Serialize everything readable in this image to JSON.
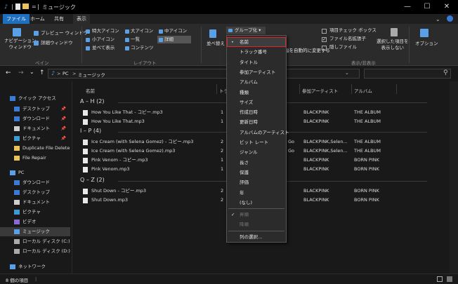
{
  "titlebar": {
    "path_separator": "|",
    "quick_dropdown": "=",
    "folder_title": "ミュージック",
    "minimize": "—",
    "maximize": "☐",
    "close": "✕"
  },
  "tabs": [
    "ファイル",
    "ホーム",
    "共有",
    "表示"
  ],
  "ribbon": {
    "pane_group": {
      "nav_pane": "ナビゲーション\nウィンドウ",
      "preview_pane": "プレビュー ウィンドウ",
      "details_pane": "詳細ウィンドウ",
      "label": "ペイン"
    },
    "layout_group": {
      "items": [
        "特大アイコン",
        "大アイコン",
        "中アイコン",
        "小アイコン",
        "一覧",
        "詳細",
        "並べて表示",
        "コンテンツ"
      ],
      "label": "レイアウト"
    },
    "view_group": {
      "sort": "並べ替え",
      "group_by": "グループ化 ▾",
      "size_all_columns": "列の幅を自動的に変更する"
    },
    "show_hide": {
      "item_checkboxes": "項目チェック ボックス",
      "file_extensions": "ファイル名拡張子",
      "hidden_items": "隠しファイル",
      "hide_selected": "選択した項目を\n表示しない",
      "options": "オプション",
      "label": "表示/非表示"
    }
  },
  "address": {
    "back": "←",
    "forward": "→",
    "recent": "⌄",
    "up": "↑",
    "path": [
      "PC",
      "ミュージック"
    ],
    "path_separators": [
      ">",
      ">"
    ],
    "refresh": "⌄",
    "search_icon": "⚲"
  },
  "nav_pane": [
    {
      "label": "クイック アクセス",
      "icon": "star-icon",
      "pinned": false,
      "indent": 0
    },
    {
      "label": "デスクトップ",
      "icon": "desktop-icon",
      "pinned": true,
      "indent": 1
    },
    {
      "label": "ダウンロード",
      "icon": "download-icon",
      "pinned": true,
      "indent": 1
    },
    {
      "label": "ドキュメント",
      "icon": "document-icon",
      "pinned": true,
      "indent": 1
    },
    {
      "label": "ピクチャ",
      "icon": "picture-icon",
      "pinned": true,
      "indent": 1
    },
    {
      "label": "Duplicate File Deleter",
      "icon": "folder-icon",
      "pinned": false,
      "indent": 1
    },
    {
      "label": "File Repair",
      "icon": "folder-icon",
      "pinned": false,
      "indent": 1
    },
    {
      "label": "PC",
      "icon": "pc-icon",
      "pinned": false,
      "indent": 0
    },
    {
      "label": "ダウンロード",
      "icon": "download-icon",
      "pinned": false,
      "indent": 1
    },
    {
      "label": "デスクトップ",
      "icon": "desktop-icon",
      "pinned": false,
      "indent": 1
    },
    {
      "label": "ドキュメント",
      "icon": "document-icon",
      "pinned": false,
      "indent": 1
    },
    {
      "label": "ピクチャ",
      "icon": "picture-icon",
      "pinned": false,
      "indent": 1
    },
    {
      "label": "ビデオ",
      "icon": "video-icon",
      "pinned": false,
      "indent": 1
    },
    {
      "label": "ミュージック",
      "icon": "music-icon",
      "pinned": false,
      "indent": 1,
      "selected": true
    },
    {
      "label": "ローカル ディスク (C:)",
      "icon": "disk-icon",
      "pinned": false,
      "indent": 1
    },
    {
      "label": "ローカル ディスク (D:)",
      "icon": "disk-icon",
      "pinned": false,
      "indent": 1
    },
    {
      "label": "ネットワーク",
      "icon": "network-icon",
      "pinned": false,
      "indent": 0
    }
  ],
  "pin_glyph": "📌",
  "columns": {
    "name": "名前",
    "track_partial": "トラ",
    "contributing_artist": "参加アーティスト",
    "album": "アルバム"
  },
  "groups": [
    {
      "label": "A – H (2)",
      "files": [
        {
          "name": "How You Like That - コピー.mp3",
          "track": "1",
          "artist": "BLACKPINK",
          "album": "THE ALBUM"
        },
        {
          "name": "How You Like That.mp3",
          "track": "1",
          "artist": "BLACKPINK",
          "album": "THE ALBUM"
        }
      ]
    },
    {
      "label": "I – P (4)",
      "files": [
        {
          "name": "Ice Cream (with Selena Gomez) - コピー.mp3",
          "track": "2",
          "artist": "BLACKPINK,Selen...",
          "album": "THE ALBUM",
          "extra": "Go"
        },
        {
          "name": "Ice Cream (with Selena Gomez).mp3",
          "track": "2",
          "artist": "BLACKPINK,Selen...",
          "album": "THE ALBUM",
          "extra": "Go"
        },
        {
          "name": "Pink Venom - コピー.mp3",
          "track": "1",
          "artist": "BLACKPINK",
          "album": "BORN PINK"
        },
        {
          "name": "Pink Venom.mp3",
          "track": "1",
          "artist": "BLACKPINK",
          "album": "BORN PINK"
        }
      ]
    },
    {
      "label": "Q – Z (2)",
      "files": [
        {
          "name": "Shut Down - コピー.mp3",
          "track": "2",
          "artist": "BLACKPINK",
          "album": "BORN PINK"
        },
        {
          "name": "Shut Down.mp3",
          "track": "2",
          "artist": "BLACKPINK",
          "album": "BORN PINK"
        }
      ]
    }
  ],
  "group_menu": {
    "items": [
      {
        "label": "名前",
        "mark": "•",
        "highlighted": true
      },
      {
        "label": "トラック番号"
      },
      {
        "label": "タイトル"
      },
      {
        "label": "参加アーティスト"
      },
      {
        "label": "アルバム"
      },
      {
        "label": "種類"
      },
      {
        "label": "サイズ"
      },
      {
        "label": "作成日時"
      },
      {
        "label": "更新日時"
      },
      {
        "label": "アルバムのアーティスト"
      },
      {
        "label": "ビット レート"
      },
      {
        "label": "ジャンル"
      },
      {
        "label": "長さ"
      },
      {
        "label": "保護"
      },
      {
        "label": "評価"
      },
      {
        "label": "年"
      },
      {
        "label": "(なし)"
      },
      {
        "label": "昇順",
        "mark": "✓",
        "disabled": true
      },
      {
        "label": "降順",
        "disabled": true
      },
      {
        "label": "列の選択..."
      }
    ]
  },
  "status": {
    "count": "8 個の項目",
    "separator": "|"
  },
  "colors": {
    "accent": "#1e6fbf",
    "highlight_outline": "#e02424",
    "bg": "#191919",
    "ribbon": "#2b2b2b"
  }
}
